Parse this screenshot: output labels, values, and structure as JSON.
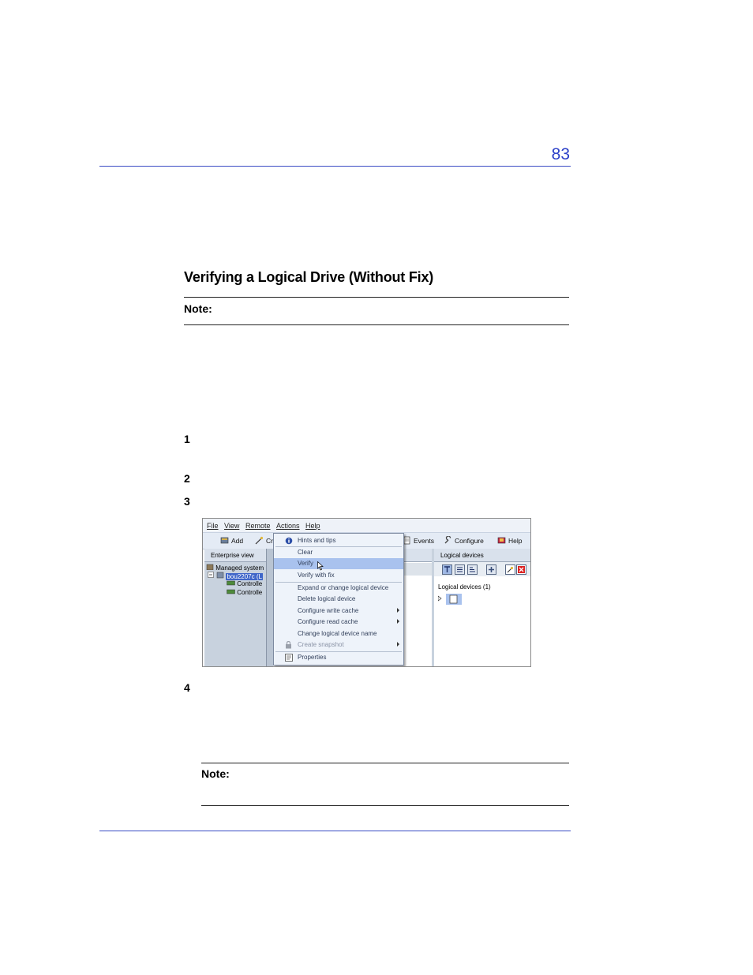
{
  "page": {
    "number": "83",
    "section_title": "Verifying a Logical Drive (Without Fix)",
    "note1_label": "Note:",
    "steps": [
      "1",
      "2",
      "3",
      "4"
    ],
    "note2_label": "Note:"
  },
  "screenshot": {
    "menubar": [
      "File",
      "View",
      "Remote",
      "Actions",
      "Help"
    ],
    "toolbar": {
      "add": "Add",
      "create_partial": "Cr",
      "events": "Events",
      "configure": "Configure",
      "help": "Help"
    },
    "left_pane": {
      "header": "Enterprise view",
      "tree": [
        "Managed system",
        "bou2207c (L",
        "Controlle",
        "Controlle"
      ]
    },
    "context_menu": {
      "items": [
        "Hints and tips",
        "Clear",
        "Verify",
        "Verify with fix",
        "Expand or change logical device",
        "Delete logical device",
        "Configure write cache",
        "Configure read cache",
        "Change logical device name",
        "Create snapshot",
        "Properties"
      ],
      "selected": "Verify"
    },
    "right_pane": {
      "header": "Logical devices",
      "list_label": "Logical devices (1)"
    },
    "colors": {
      "menu_highlight": "#a9c2ee",
      "accent_blue": "#2b3fc8"
    }
  }
}
